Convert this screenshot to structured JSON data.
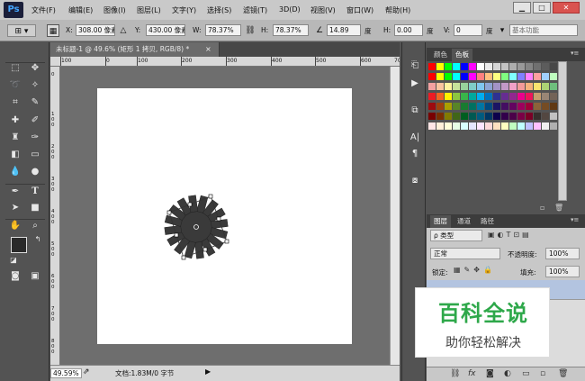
{
  "app": {
    "logo": "Ps",
    "menu": [
      "文件(F)",
      "编辑(E)",
      "图像(I)",
      "图层(L)",
      "文字(Y)",
      "选择(S)",
      "滤镜(T)",
      "3D(D)",
      "视图(V)",
      "窗口(W)",
      "帮助(H)"
    ],
    "window_buttons": [
      "▁",
      "□",
      "✕"
    ]
  },
  "options": {
    "x_label": "X:",
    "x_value": "308.00 像素",
    "y_label": "Y:",
    "y_value": "430.00 像素",
    "w_label": "W:",
    "w_value": "78.37%",
    "h_label": "H:",
    "h_value": "78.37%",
    "angle_value": "14.89",
    "angle_unit": "度",
    "hskew_label": "H:",
    "hskew_value": "0.00",
    "hskew_unit": "度",
    "vskew_label": "V:",
    "vskew_value": "0",
    "vskew_unit": "度",
    "workspace": "基本功能"
  },
  "document": {
    "tab_title": "未标题-1 @ 49.6% (矩形 1 拷贝, RGB/8) *",
    "tab_close": "×",
    "ruler_top": [
      "100",
      "0",
      "100",
      "200",
      "300",
      "400",
      "500",
      "600",
      "700",
      "800"
    ],
    "ruler_left": [
      "0",
      "1 0 0",
      "2 0 0",
      "3 0 0",
      "4 0 0",
      "5 0 0",
      "6 0 0",
      "7 0 0",
      "8 0 0"
    ],
    "zoom": "49.59%",
    "doc_info": "文档:1.83M/0 字节"
  },
  "panels": {
    "color_tabs": [
      "颜色",
      "色板"
    ],
    "layer_tabs": [
      "图层",
      "通道",
      "路径"
    ],
    "filter_kind": "ρ 类型",
    "blend_mode": "正常",
    "opacity_label": "不透明度:",
    "opacity_value": "100%",
    "lock_label": "锁定:",
    "fill_label": "填充:",
    "fill_value": "100%"
  },
  "swatch_colors": [
    [
      "#ff0000",
      "#ffff00",
      "#00ff00",
      "#00ffff",
      "#0000ff",
      "#ff00ff",
      "#ffffff",
      "#ebebeb",
      "#d6d6d6",
      "#c2c2c2",
      "#adadad",
      "#999999",
      "#858585",
      "#707070",
      "#5c5c5c",
      "#474747",
      "#333333",
      "#1f1f1f",
      "#000000"
    ],
    [
      "#ff0000",
      "#ffff00",
      "#00ff00",
      "#00ffff",
      "#0000ff",
      "#ff00ff",
      "#ff8080",
      "#ffc080",
      "#ffff80",
      "#80ff80",
      "#80ffff",
      "#8080ff",
      "#ff80ff",
      "#ffa0a0",
      "#a0d0ff",
      "#c0ffc0",
      "#fff0a0",
      "#e0c0ff",
      "#ffd0e0"
    ],
    [
      "#f4a1a1",
      "#f9c49f",
      "#fdf29e",
      "#c7e29a",
      "#98d39c",
      "#7fcdc7",
      "#80c6ee",
      "#8ea4d4",
      "#a393c6",
      "#c399c7",
      "#f2a1c7",
      "#f49a9a",
      "#f6b27c",
      "#fbe46f",
      "#acd274",
      "#6fbf7d",
      "#4fb8b3",
      "#4cb2e8",
      "#6a8cc7"
    ],
    [
      "#ed1c24",
      "#f26522",
      "#fff200",
      "#8dc63f",
      "#39b54a",
      "#00a99d",
      "#00aeef",
      "#0072bc",
      "#2e3192",
      "#662d91",
      "#92278f",
      "#ec008c",
      "#ed145b",
      "#c69c6d",
      "#998675",
      "#736357",
      "#534741",
      "#c7b299",
      "#a67c52"
    ],
    [
      "#9e0b0f",
      "#a0410d",
      "#aba000",
      "#598527",
      "#197b30",
      "#007161",
      "#0076a3",
      "#004a80",
      "#1b1464",
      "#440e62",
      "#630460",
      "#9e005d",
      "#9e0039",
      "#8c6239",
      "#754c24",
      "#603913",
      "#42210b",
      "#c69c6d",
      "#8c6239"
    ],
    [
      "#790000",
      "#7b2e00",
      "#827b00",
      "#406618",
      "#005e20",
      "#005952",
      "#005b7f",
      "#003663",
      "#0d004c",
      "#32004b",
      "#4b0049",
      "#7b0046",
      "#7a0026",
      "#362f2d",
      "#534741",
      "#c2c2c2",
      "#ebebeb",
      "#f2e0c9",
      "#e6c9a8"
    ],
    [
      "#ffe6e6",
      "#fff0d9",
      "#ffffd9",
      "#e6ffe6",
      "#d9ffff",
      "#e6e6ff",
      "#ffe6ff",
      "#ffd9d9",
      "#ffe0c0",
      "#ffffc0",
      "#c0ffc0",
      "#c0ffff",
      "#c0c0ff",
      "#ffc0ff",
      "#f0f0f0",
      "#b0b0b0",
      "#606060",
      "#303030",
      "#000000"
    ]
  ]
}
